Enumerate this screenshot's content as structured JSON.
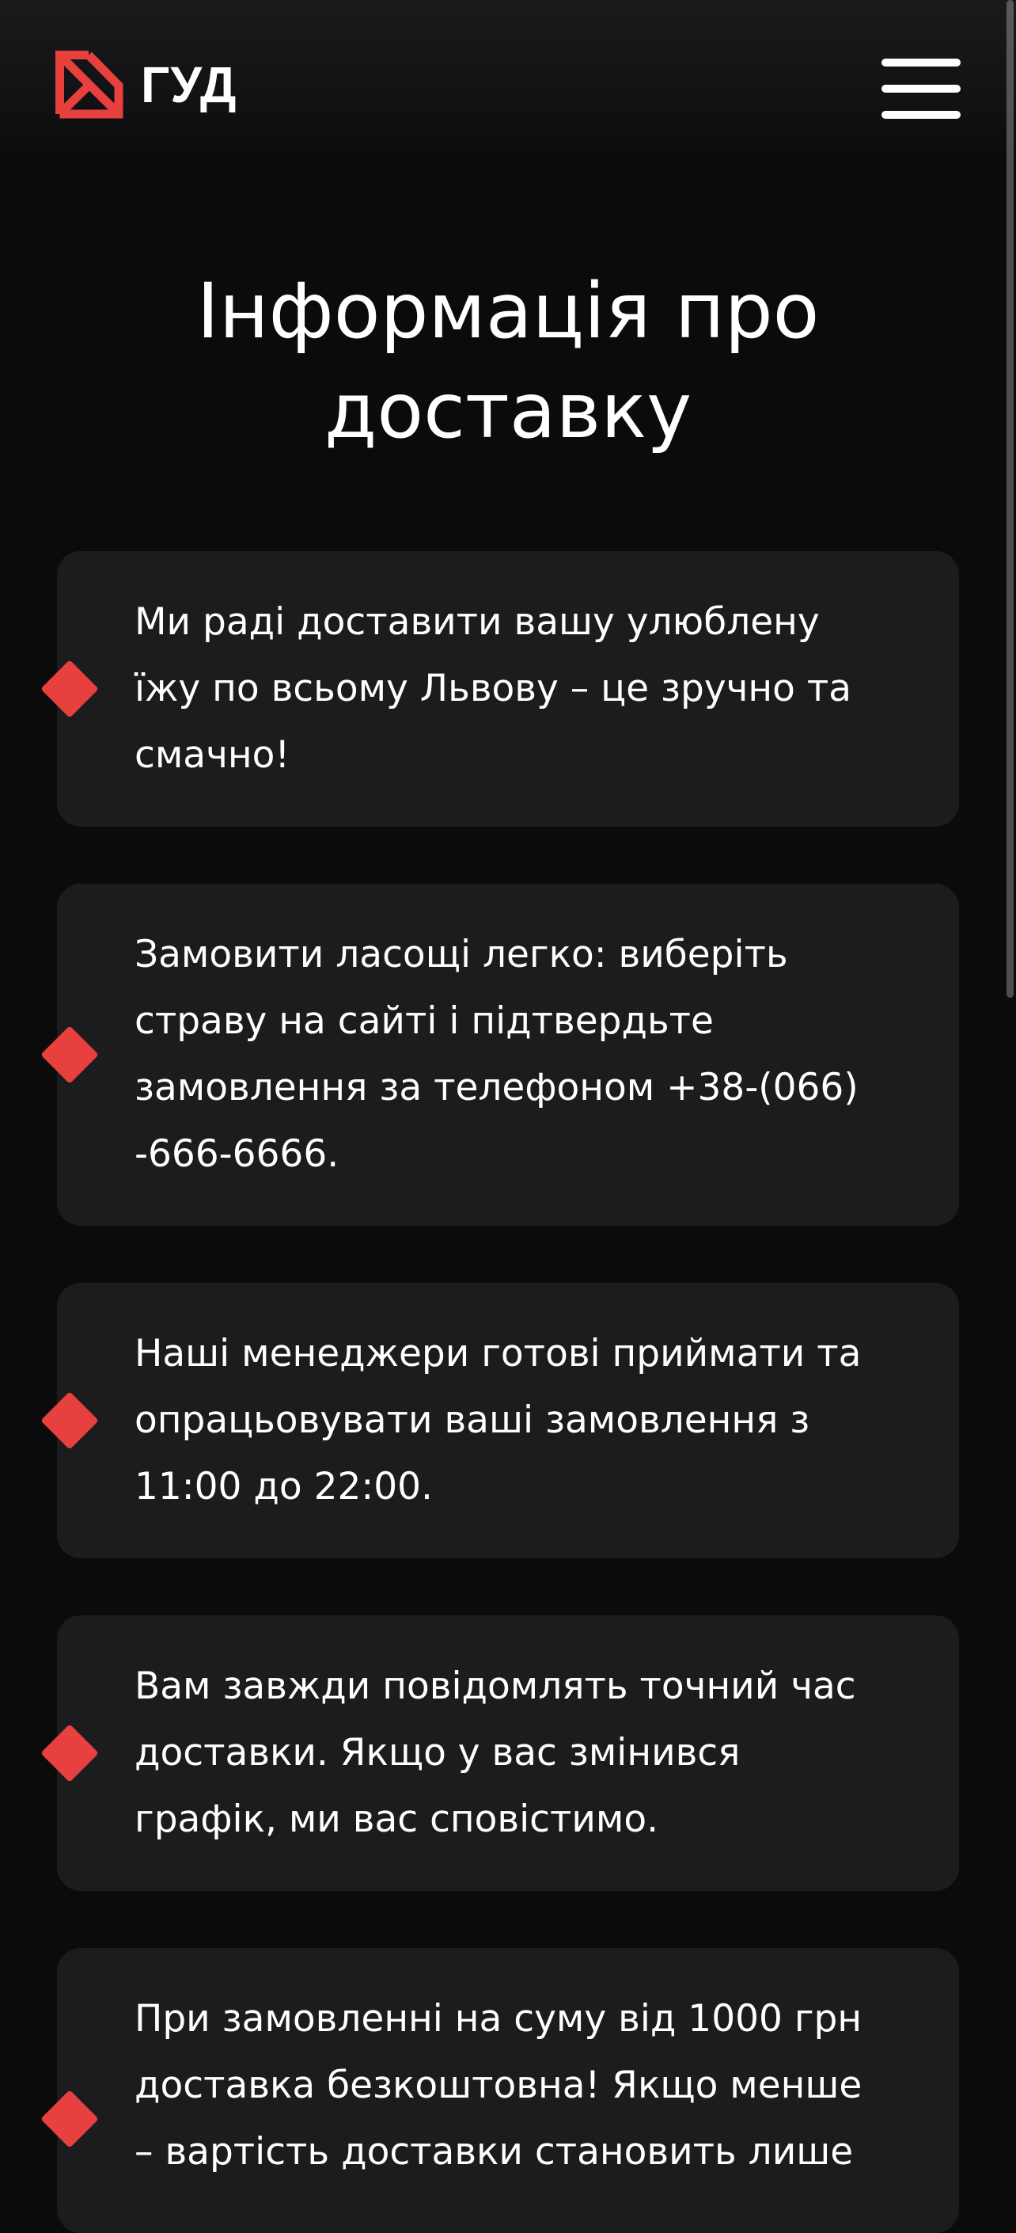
{
  "header": {
    "logo_text": "ГУД",
    "menu_icon": "hamburger-menu-icon"
  },
  "main": {
    "title_line1": "Інформація про",
    "title_line2": "доставку",
    "cards": [
      {
        "lines": [
          "Ми раді доставити вашу улюблену",
          "їжу по всьому Львову – це зручно та",
          "смачно!"
        ]
      },
      {
        "lines": [
          "Замовити ласощі легко: виберіть",
          "страву на сайті і підтвердьте",
          "замовлення за телефоном +38-(066)",
          "-666-6666."
        ]
      },
      {
        "lines": [
          "Наші менеджери готові приймати та",
          "опрацьовувати ваші замовлення з",
          "11:00 до 22:00."
        ]
      },
      {
        "lines": [
          "Вам завжди повідомлять точний час",
          "доставки. Якщо у вас змінився",
          "графік, ми вас сповістимо."
        ]
      },
      {
        "lines": [
          "При замовленні на суму від 1000 грн",
          "доставка безкоштовна! Якщо менше",
          "– вартість доставки становить лише"
        ]
      }
    ]
  },
  "colors": {
    "accent": "#e8403f",
    "background": "#0b0b0c",
    "card": "#1c1c1e",
    "text": "#ffffff"
  }
}
